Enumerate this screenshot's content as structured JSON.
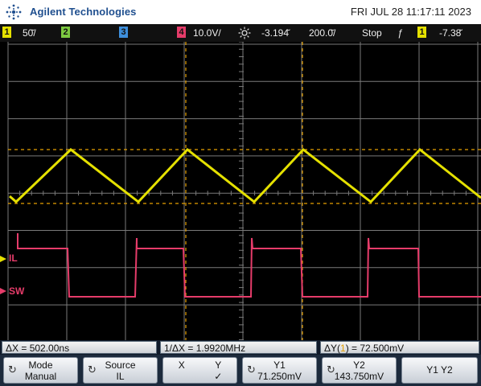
{
  "header": {
    "brand": "Agilent Technologies",
    "datetime": "FRI JUL 28 11:17:11 2023"
  },
  "status_bar": {
    "ch1_num": "1",
    "ch1_scale": "50̆/",
    "ch2_num": "2",
    "ch3_num": "3",
    "ch4_num": "4",
    "ch4_scale": "10.0V/",
    "delay_icon": "sun-icon",
    "delay": "-3.194̆",
    "timebase": "200.0̆/",
    "run_state": "Stop",
    "trigger_slope": "ƒ",
    "trigger_source": "1",
    "trigger_level": "-7.38̆"
  },
  "display": {
    "label_il": "IL",
    "label_sw": "SW",
    "colors": {
      "ch1": "#e5e100",
      "ch4": "#e63c6a",
      "cursor": "#e5a000",
      "grid": "#8a8a8a"
    }
  },
  "measurements": {
    "dx": "ΔX = 502.00ns",
    "inv_dx": "1/ΔX = 1.9920MHz",
    "dy_prefix": "ΔY(",
    "dy_ch": "1",
    "dy_suffix": ") = 72.500mV"
  },
  "softkeys": {
    "mode_label": "Mode",
    "mode_value": "Manual",
    "source_label": "Source",
    "source_value": "IL",
    "x_label": "X",
    "y_label": "Y",
    "y_check": "✓",
    "y1_label": "Y1",
    "y1_value": "71.250mV",
    "y2_label": "Y2",
    "y2_value": "143.750mV",
    "y1y2_label": "Y1 Y2"
  }
}
